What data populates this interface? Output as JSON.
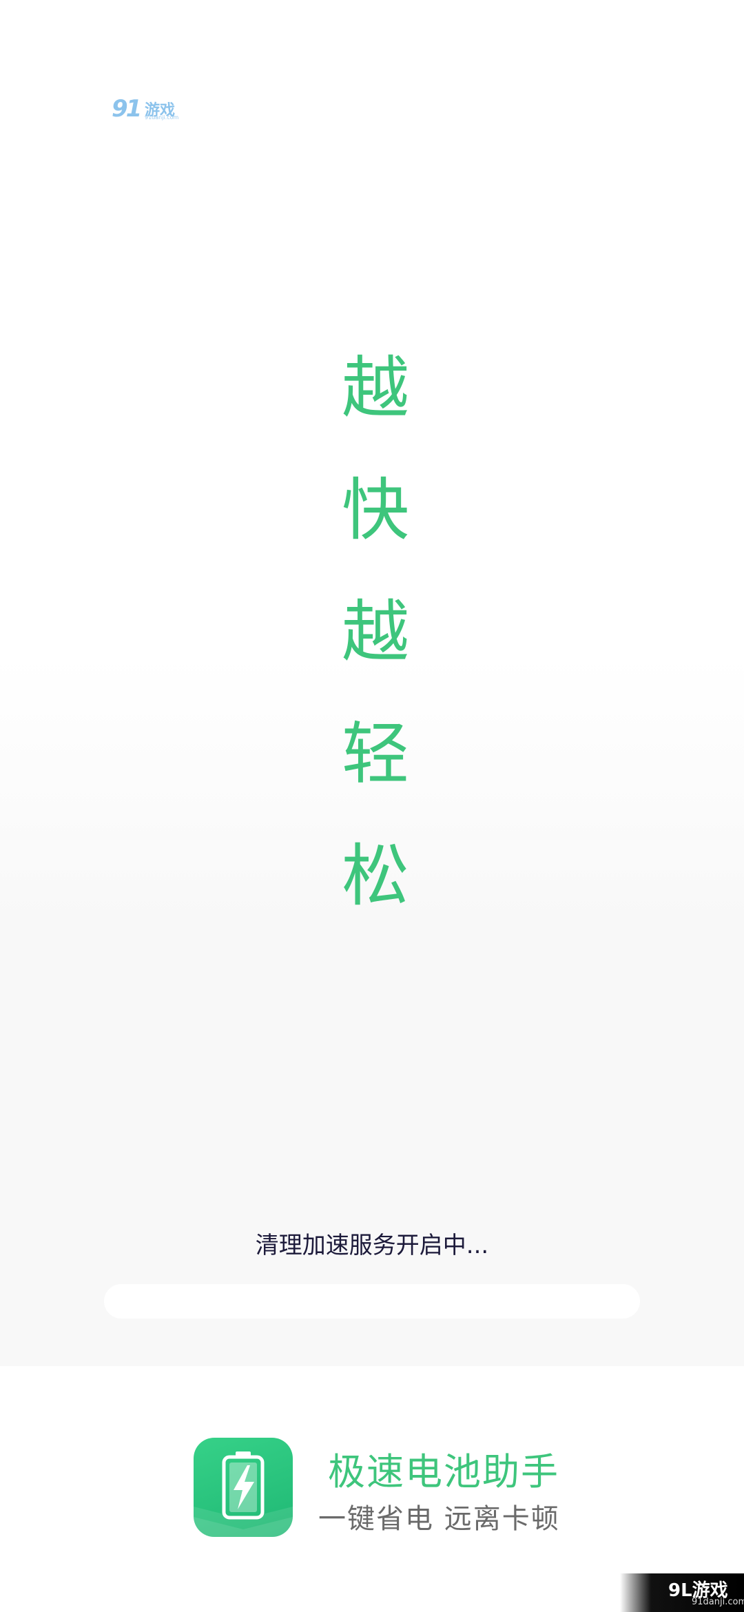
{
  "watermark": {
    "top_logo_number": "91",
    "top_logo_text": "游戏",
    "top_logo_url": "91danji.com",
    "bottom_logo_text": "9L游戏",
    "bottom_logo_url": "91danji.com"
  },
  "slogan": {
    "chars": [
      "越",
      "快",
      "越",
      "轻",
      "松"
    ]
  },
  "status": {
    "text": "清理加速服务开启中...",
    "progress": 0
  },
  "app": {
    "name": "极速电池助手",
    "tagline": "一键省电 远离卡顿",
    "icon": "battery-bolt-icon"
  },
  "colors": {
    "accent_green": "#3ec57c",
    "status_text": "#1c1a3a",
    "tagline_gray": "#6a6a6a"
  }
}
